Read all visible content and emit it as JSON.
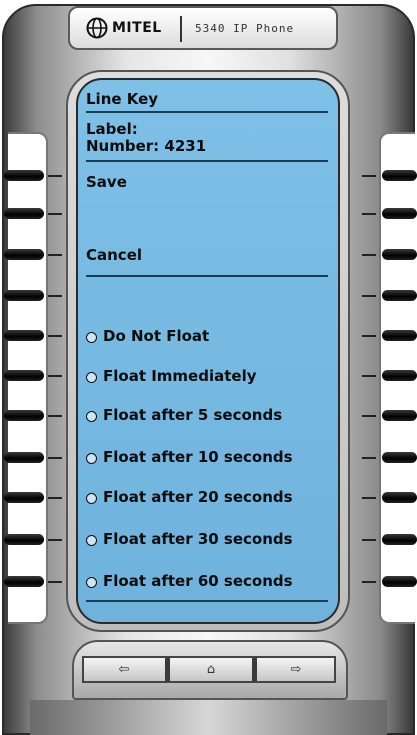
{
  "brand": {
    "logo_text": "MITEL",
    "model": "5340 IP Phone",
    "logo_icon": "mitel-globe-icon"
  },
  "screen": {
    "title": "Line Key",
    "label_line": "Label:",
    "number_line": "Number: 4231",
    "save_label": "Save",
    "cancel_label": "Cancel",
    "options": [
      "Do Not Float",
      "Float Immediately",
      "Float after 5 seconds",
      "Float after 10 seconds",
      "Float after 20 seconds",
      "Float after 30 seconds",
      "Float after 60 seconds"
    ]
  },
  "nav": {
    "left_icon": "arrow-left-icon",
    "home_icon": "home-icon",
    "right_icon": "arrow-right-icon",
    "left_glyph": "⇦",
    "home_glyph": "⌂",
    "right_glyph": "⇨"
  },
  "colors": {
    "screen": "#7ec0e6",
    "body": "#e6e6e6",
    "keys": "#000000"
  }
}
